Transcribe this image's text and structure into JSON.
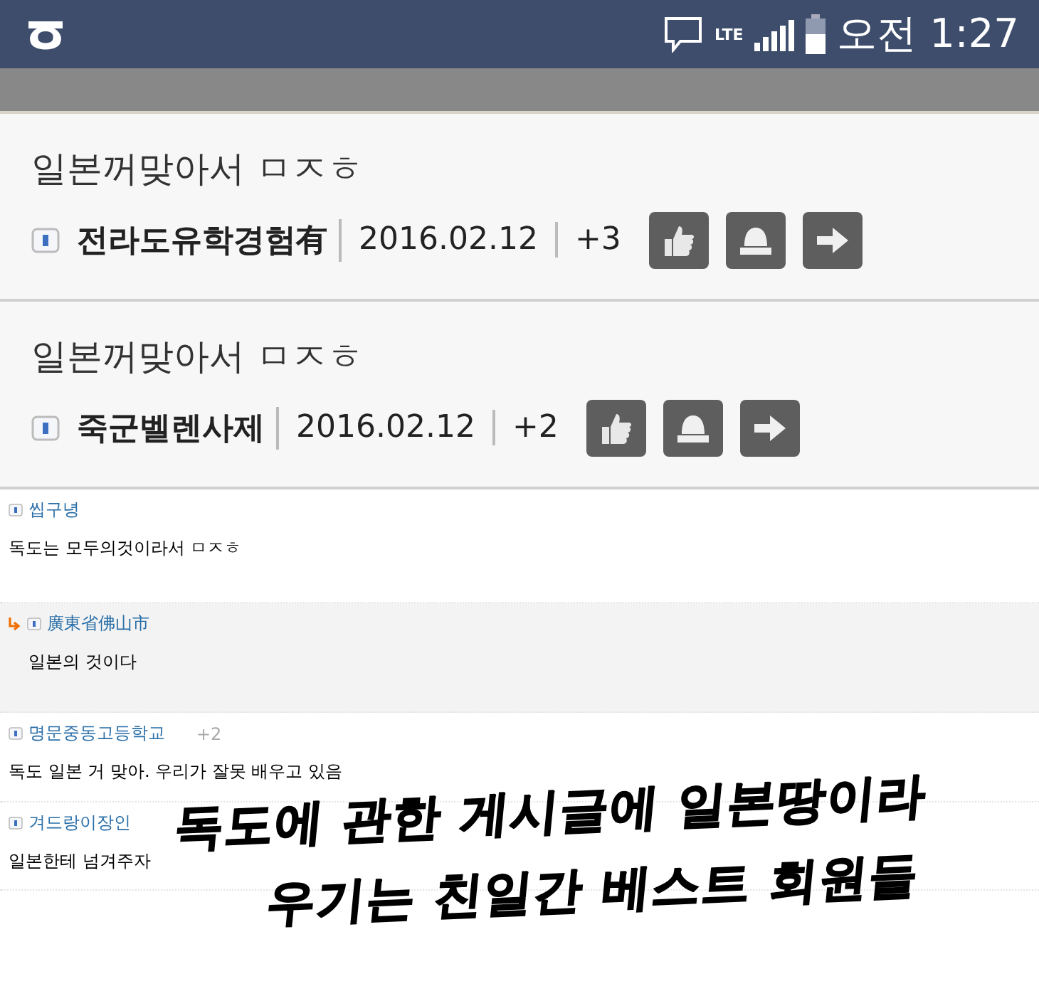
{
  "status_bar": {
    "time": "오전 1:27",
    "network": "LTE"
  },
  "posts": [
    {
      "title": "일본꺼맞아서 ㅁㅈㅎ",
      "author": "전라도유학경험有",
      "date": "2016.02.12",
      "score": "+3"
    },
    {
      "title": "일본꺼맞아서 ㅁㅈㅎ",
      "author": "죽군벨렌사제",
      "date": "2016.02.12",
      "score": "+2"
    }
  ],
  "comments": [
    {
      "kind": "comment",
      "author": "씹구녕",
      "text": "독도는 모두의것이라서 ㅁㅈㅎ"
    },
    {
      "kind": "reply",
      "author": "廣東省佛山市",
      "text": "일본의 것이다"
    },
    {
      "kind": "comment",
      "author": "명문중동고등학교",
      "score": "+2",
      "text": "독도 일본 거 맞아. 우리가 잘못 배우고 있음"
    },
    {
      "kind": "comment",
      "author": "겨드랑이장인",
      "text": "일본한테 넘겨주자"
    }
  ],
  "caption": [
    "독도에 관한 게시글에 일본땅이라",
    "우기는 친일간 베스트 회원들"
  ]
}
